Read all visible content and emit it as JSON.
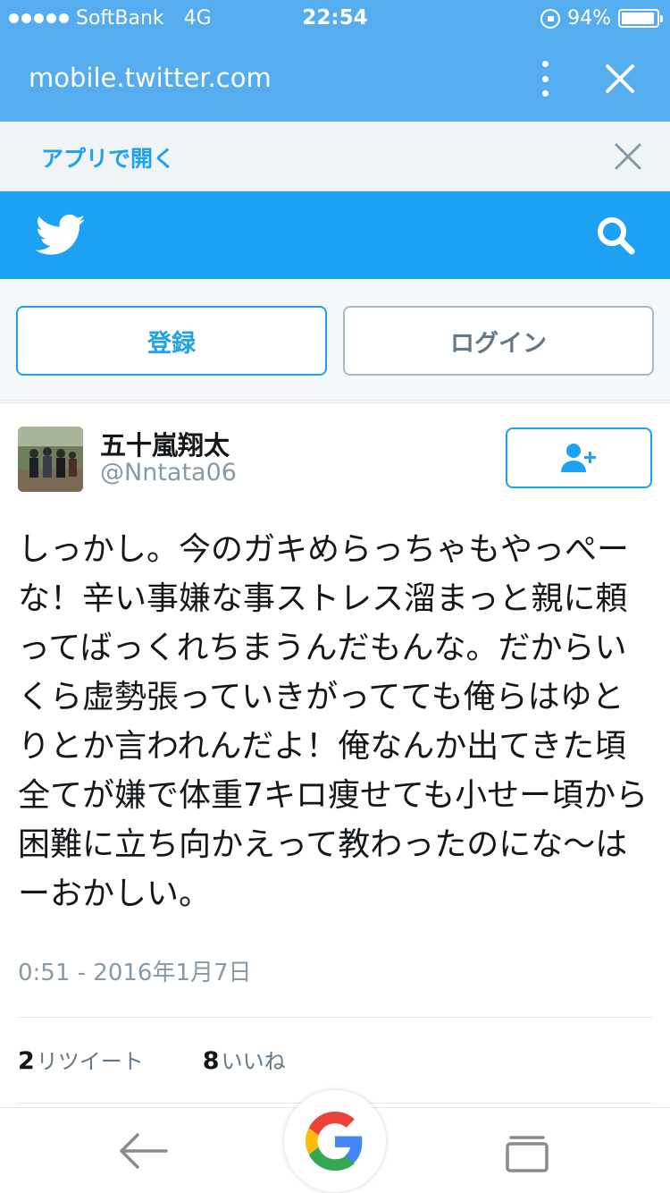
{
  "status_bar": {
    "carrier": "SoftBank",
    "network": "4G",
    "time": "22:54",
    "battery_percent": "94%",
    "battery_level": 0.94
  },
  "browser": {
    "url": "mobile.twitter.com",
    "menu_icon": "kebab-menu-icon",
    "close_icon": "close-icon"
  },
  "app_banner": {
    "label": "アプリで開く",
    "close_icon": "close-icon"
  },
  "header": {
    "logo_icon": "twitter-bird-icon",
    "search_icon": "search-icon",
    "color": "#1da1f2"
  },
  "auth": {
    "signup_label": "登録",
    "login_label": "ログイン"
  },
  "tweet": {
    "author_name": "五十嵐翔太",
    "author_handle": "@Nntata06",
    "follow_icon": "add-user-icon",
    "text": "しっかし。今のガキめらっちゃもやっぺーな！辛い事嫌な事ストレス溜まっと親に頼ってばっくれちまうんだもんな。だからいくら虚勢張っていきがってても俺らはゆとりとか言われんだよ！俺なんか出てきた頃全てが嫌で体重7キロ痩せても小せー頃から困難に立ち向かえって教わったのにな〜はーおかしい。",
    "timestamp": "0:51 - 2016年1月7日",
    "retweets": {
      "count": "2",
      "label": "リツイート"
    },
    "likes": {
      "count": "8",
      "label": "いいね"
    }
  },
  "bottom_bar": {
    "back_icon": "back-arrow-icon",
    "google_icon": "google-g-icon",
    "tabs_icon": "tabs-icon"
  }
}
